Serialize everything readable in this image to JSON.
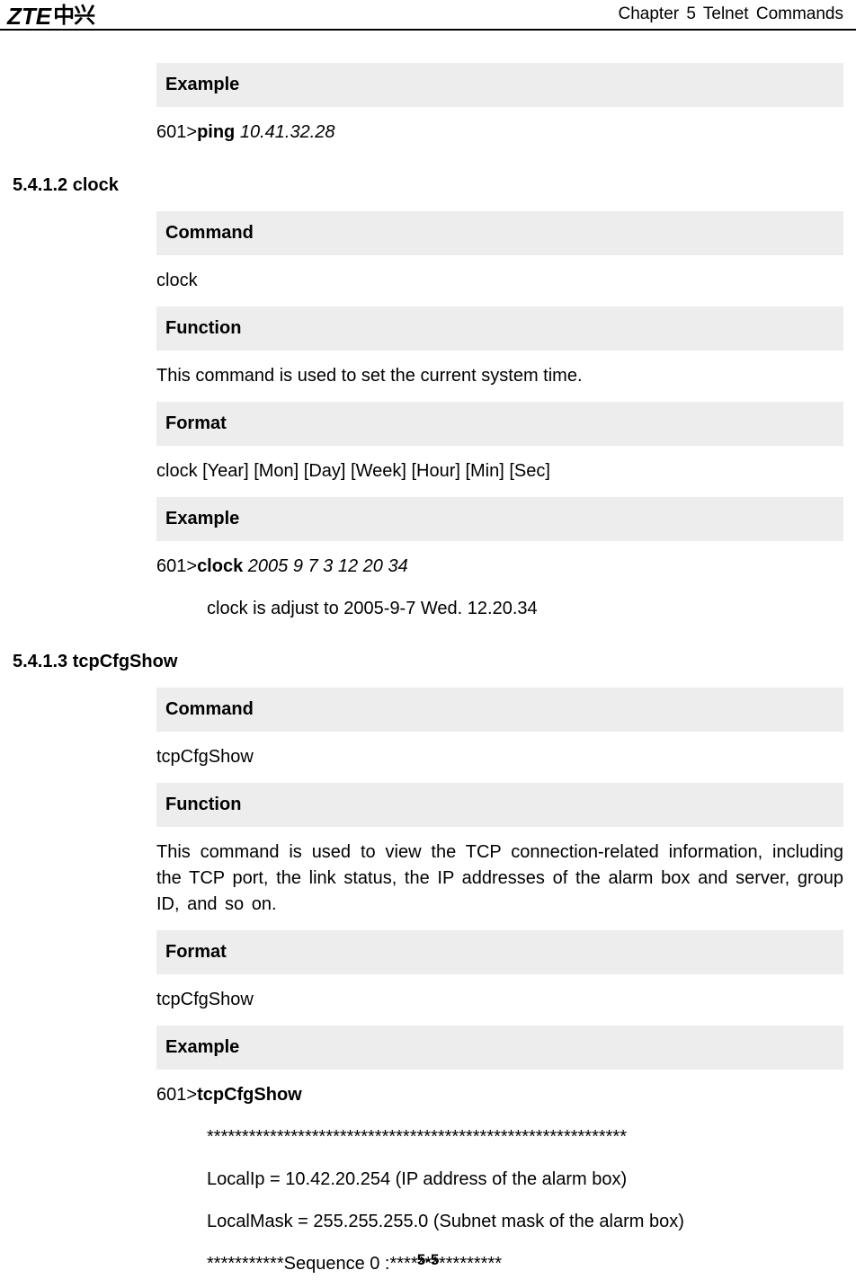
{
  "header": {
    "logo_zte": "ZTE",
    "logo_cn": "中兴",
    "chapter": "Chapter 5   Telnet  Commands"
  },
  "sections": {
    "s0": {
      "example_label": "Example",
      "example_prefix": "601>",
      "example_cmd": "ping",
      "example_arg": " 10.41.32.28"
    },
    "s1": {
      "heading": "5.4.1.2 clock",
      "command_label": "Command",
      "command_value": "clock",
      "function_label": "Function",
      "function_value": "This command is used to set the current system time.",
      "format_label": "Format",
      "format_value": "clock [Year] [Mon] [Day] [Week] [Hour] [Min] [Sec]",
      "example_label": "Example",
      "example_prefix": "601>",
      "example_cmd": "clock",
      "example_arg": " 2005 9 7 3 12 20 34",
      "example_output": "clock is adjust to 2005-9-7 Wed. 12.20.34"
    },
    "s2": {
      "heading": "5.4.1.3 tcpCfgShow",
      "command_label": "Command",
      "command_value": "tcpCfgShow",
      "function_label": "Function",
      "function_value": "This  command  is  used  to  view  the  TCP  connection-related  information, including the TCP port, the link status, the IP addresses of the alarm box and server, group ID, and so on.",
      "format_label": "Format",
      "format_value": "tcpCfgShow",
      "example_label": "Example",
      "example_prefix": "601>",
      "example_cmd": "tcpCfgShow",
      "out1": "************************************************************",
      "out2": "LocalIp     = 10.42.20.254                 (IP address of the alarm box)",
      "out3": "LocalMask = 255.255.255.0                 (Subnet mask of the alarm box)",
      "out4": "***********Sequence 0 :****************"
    }
  },
  "footer": {
    "page": "5-5"
  }
}
